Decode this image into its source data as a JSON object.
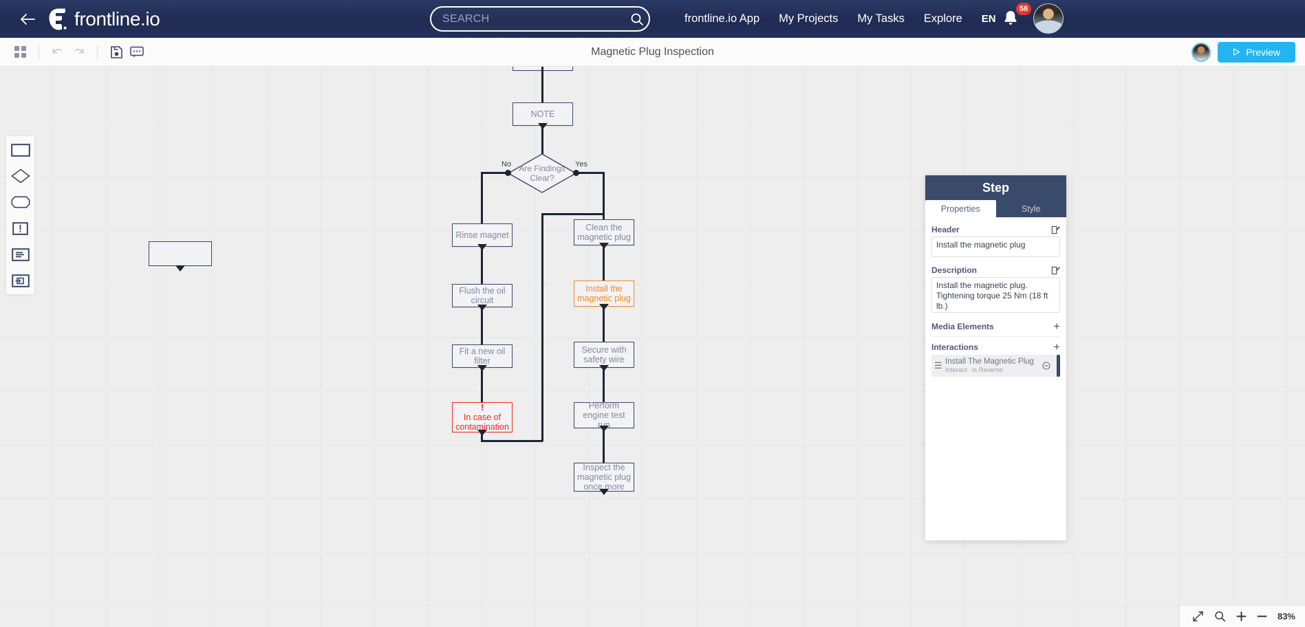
{
  "topnav": {
    "back_label": "back",
    "brand": "frontline.io",
    "search": {
      "placeholder": "SEARCH",
      "value": ""
    },
    "links": [
      {
        "label": "frontline.io App"
      },
      {
        "label": "My Projects"
      },
      {
        "label": "My Tasks"
      },
      {
        "label": "Explore"
      }
    ],
    "language": "EN",
    "notifications_count": "58"
  },
  "toolbar": {
    "document_title": "Magnetic Plug Inspection",
    "preview_label": "Preview",
    "buttons": [
      {
        "name": "grid-view",
        "icon": "grid-icon"
      },
      {
        "name": "undo",
        "icon": "undo-icon"
      },
      {
        "name": "redo",
        "icon": "redo-icon"
      },
      {
        "name": "save",
        "icon": "save-icon"
      },
      {
        "name": "comments",
        "icon": "comment-icon"
      }
    ]
  },
  "palette": {
    "items": [
      {
        "name": "rectangle-shape",
        "icon": "rectangle-icon"
      },
      {
        "name": "diamond-shape",
        "icon": "diamond-icon"
      },
      {
        "name": "rounded-shape",
        "icon": "rounded-rect-icon"
      },
      {
        "name": "warning-shape",
        "icon": "exclamation-box-icon"
      },
      {
        "name": "note-shape",
        "icon": "note-icon"
      },
      {
        "name": "link-shape",
        "icon": "link-box-icon"
      }
    ]
  },
  "flowchart": {
    "nodes": [
      {
        "id": "n_empty",
        "label": ""
      },
      {
        "id": "n_top",
        "label": ""
      },
      {
        "id": "n_note",
        "label": "NOTE"
      },
      {
        "id": "n_decision",
        "label": "Are Findings Clear?"
      },
      {
        "id": "n_rinse",
        "label": "Rinse magnet"
      },
      {
        "id": "n_flush",
        "label": "Flush the oil circuit"
      },
      {
        "id": "n_filter",
        "label": "Fit a new oil filter"
      },
      {
        "id": "n_contam",
        "label": "In case of contamination",
        "marker": "!"
      },
      {
        "id": "n_clean",
        "label": "Clean the magnetic plug"
      },
      {
        "id": "n_install",
        "label": "Install the magnetic plug"
      },
      {
        "id": "n_wire",
        "label": "Secure with safety wire"
      },
      {
        "id": "n_testrun",
        "label": "Perform engine test run"
      },
      {
        "id": "n_inspect",
        "label": "Inspect the magnetic plug once more"
      }
    ],
    "edge_labels": {
      "no": "No",
      "yes": "Yes"
    },
    "colors": {
      "node_border": "#3b4766",
      "selected": "#ef8a22",
      "warning": "#ee2b24"
    }
  },
  "step_panel": {
    "title": "Step",
    "tabs": [
      {
        "label": "Properties",
        "active": true
      },
      {
        "label": "Style",
        "active": false
      }
    ],
    "header": {
      "label": "Header",
      "value": "Install the magnetic plug"
    },
    "description": {
      "label": "Description",
      "value": "Install the magnetic plug. Tightening torque 25 Nm (18 ft lb.)"
    },
    "media_elements": {
      "label": "Media Elements",
      "add": "+"
    },
    "interactions": {
      "label": "Interactions",
      "add": "+",
      "items": [
        {
          "name": "Install The Magnetic Plug",
          "tag1": "Interact",
          "tag2": "Is Reverse"
        }
      ]
    }
  },
  "zoombar": {
    "level": "83%",
    "fit_icon": "expand-icon",
    "search_icon": "magnifier-icon",
    "zoom_in": "+",
    "zoom_out": "—"
  }
}
